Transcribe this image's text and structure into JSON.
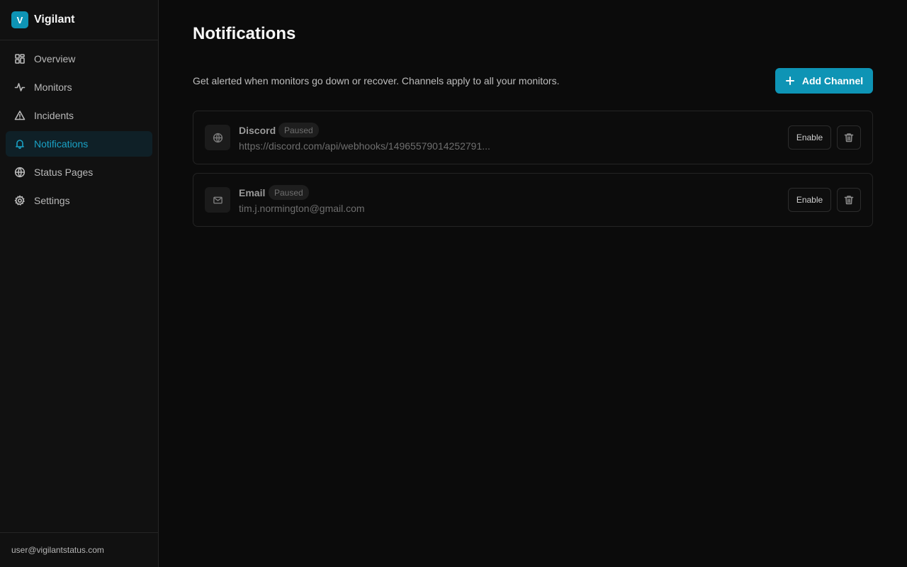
{
  "brand": {
    "logo_letter": "V",
    "name": "Vigilant",
    "accent": "#0e94b5"
  },
  "sidebar": {
    "items": [
      {
        "label": "Overview",
        "icon": "layout-grid-icon",
        "active": false
      },
      {
        "label": "Monitors",
        "icon": "activity-icon",
        "active": false
      },
      {
        "label": "Incidents",
        "icon": "alert-triangle-icon",
        "active": false
      },
      {
        "label": "Notifications",
        "icon": "bell-icon",
        "active": true
      },
      {
        "label": "Status Pages",
        "icon": "globe-icon",
        "active": false
      },
      {
        "label": "Settings",
        "icon": "gear-icon",
        "active": false
      }
    ],
    "user_email": "user@vigilantstatus.com"
  },
  "main": {
    "title": "Notifications",
    "subtitle": "Get alerted when monitors go down or recover. Channels apply to all your monitors.",
    "add_button_label": "Add Channel",
    "channels": [
      {
        "name": "Discord",
        "status": "Paused",
        "detail": "https://discord.com/api/webhooks/14965579014252791...",
        "icon": "globe-icon",
        "action_label": "Enable"
      },
      {
        "name": "Email",
        "status": "Paused",
        "detail": "tim.j.normington@gmail.com",
        "icon": "mail-icon",
        "action_label": "Enable"
      }
    ]
  }
}
